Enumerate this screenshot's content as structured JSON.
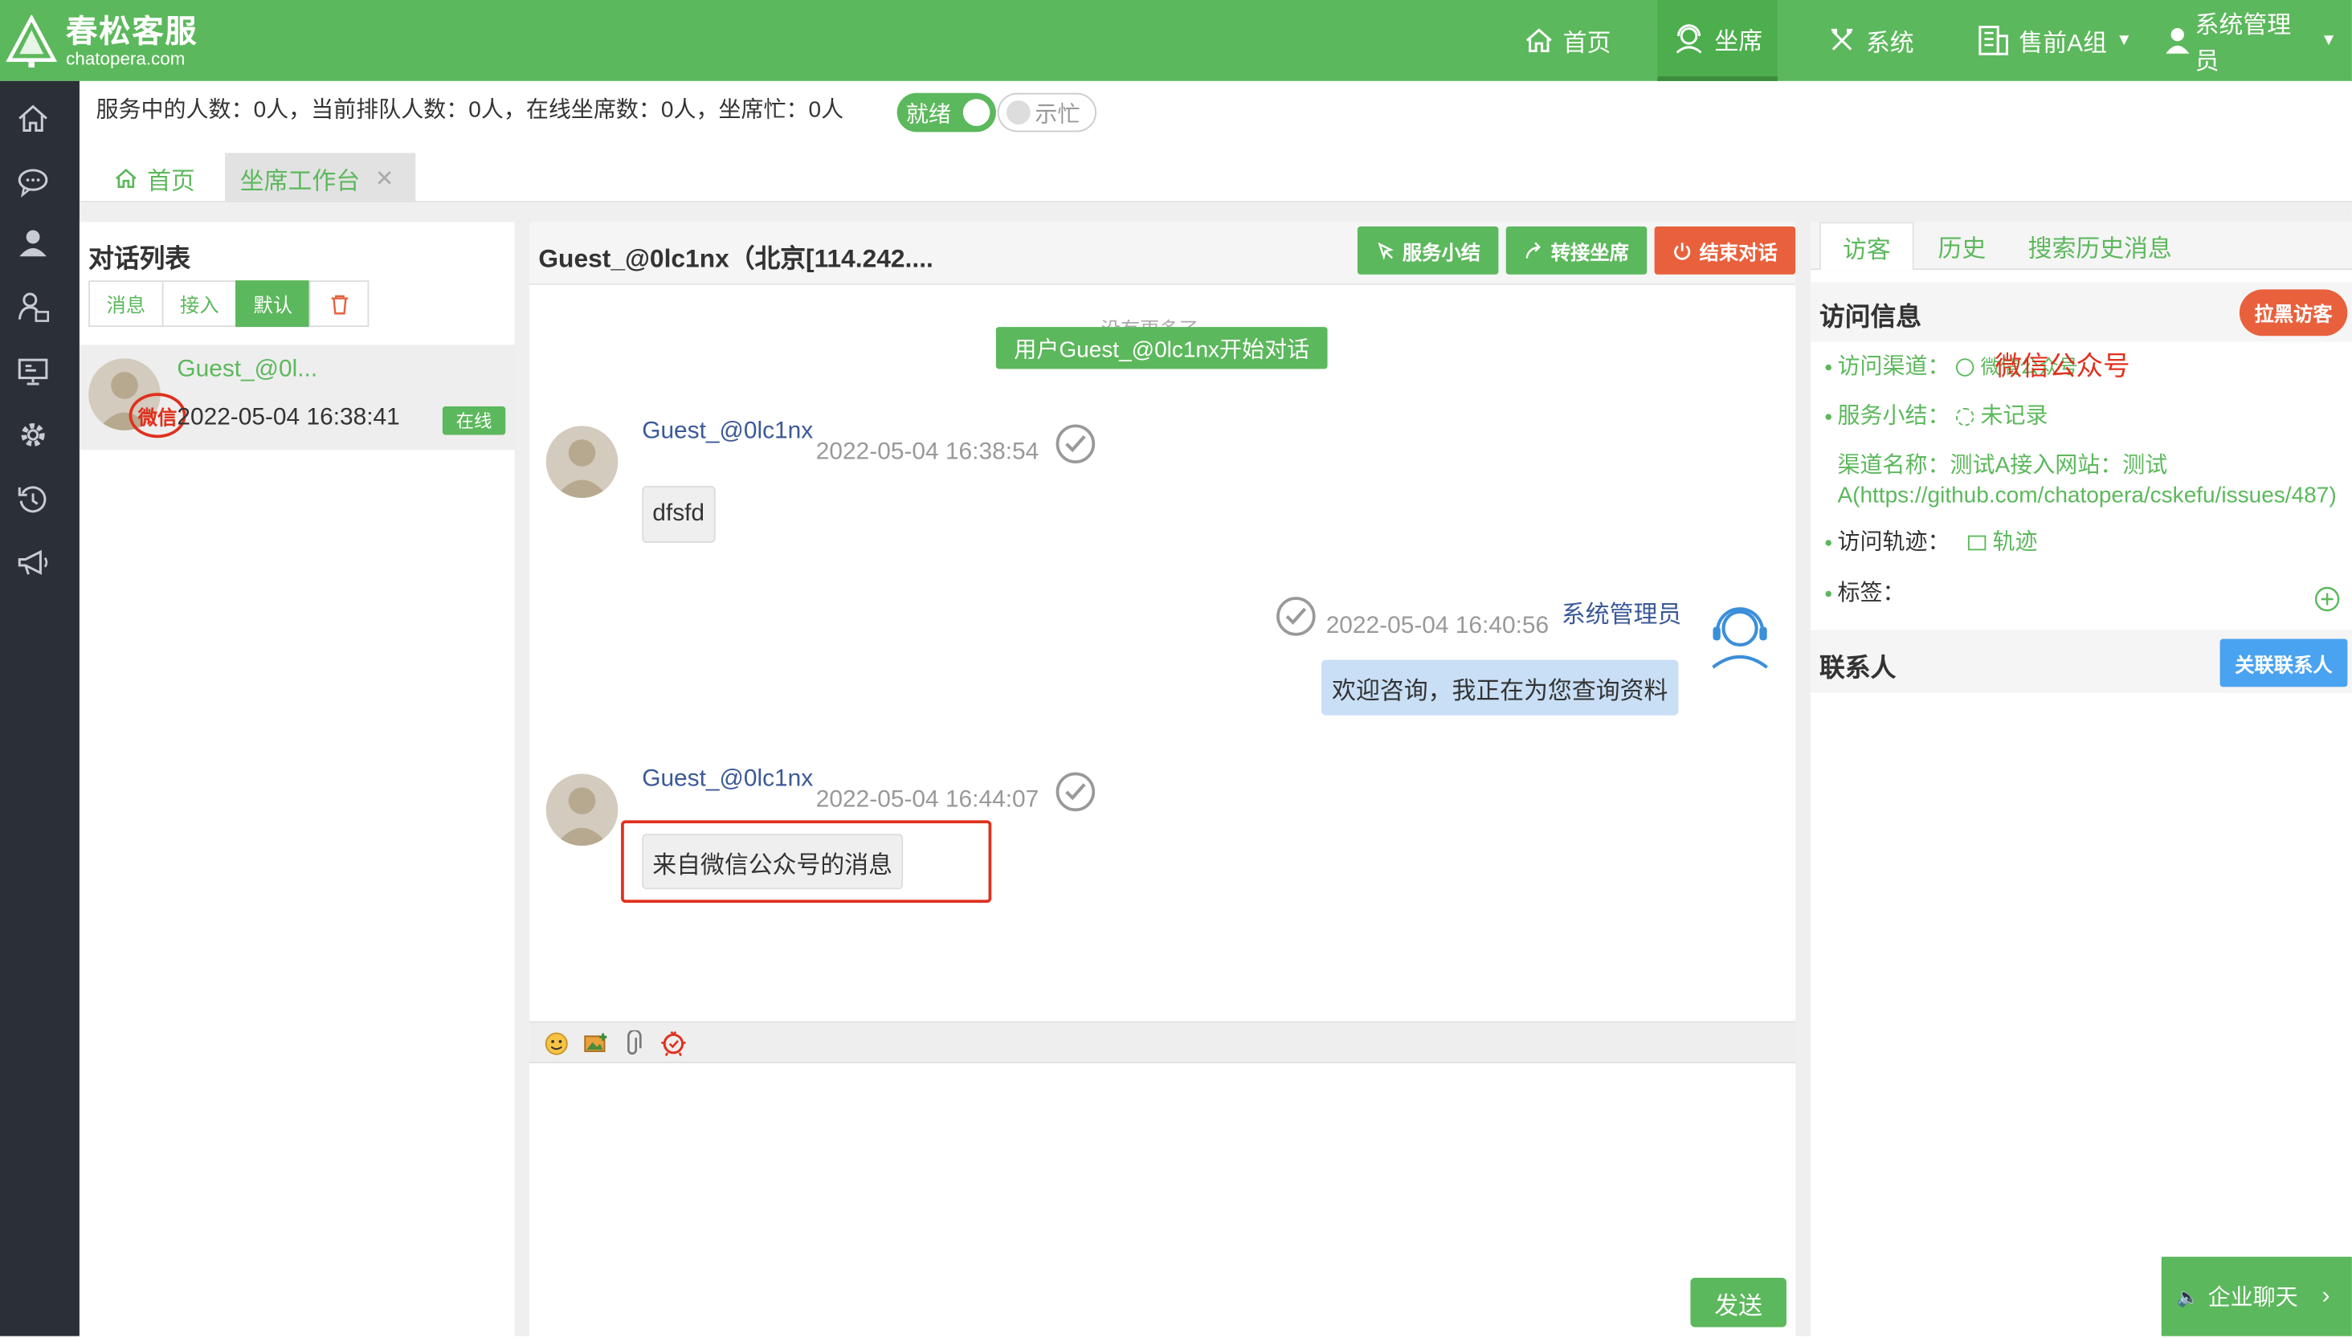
{
  "header": {
    "brand_name": "春松客服",
    "brand_url": "chatopera.com",
    "nav": [
      {
        "label": "首页",
        "icon": "home-icon"
      },
      {
        "label": "坐席",
        "icon": "agent-icon",
        "active": true
      },
      {
        "label": "系统",
        "icon": "tools-icon"
      },
      {
        "label": "售前A组",
        "icon": "building-icon"
      },
      {
        "label": "系统管理员",
        "icon": "user-icon"
      }
    ]
  },
  "sidebar": {
    "icons": [
      "home-icon",
      "chat-icon",
      "user-icon",
      "contact-icon",
      "monitor-icon",
      "gear-icon",
      "history-icon",
      "megaphone-icon"
    ]
  },
  "stats": {
    "text": "服务中的人数：0人，当前排队人数：0人，在线坐席数：0人，坐席忙：0人",
    "ready_label": "就绪",
    "busy_label": "示忙"
  },
  "tabs": [
    {
      "label": "首页"
    },
    {
      "label": "坐席工作台"
    }
  ],
  "conversation_list": {
    "title": "对话列表",
    "filters": [
      "消息",
      "接入",
      "默认"
    ],
    "items": [
      {
        "name": "Guest_@0l...",
        "time": "2022-05-04 16:38:41",
        "status": "在线",
        "channel_badge": "微信"
      }
    ]
  },
  "chat": {
    "title": "Guest_@0lc1nx（北京[114.242....",
    "actions": {
      "summary": "服务小结",
      "transfer": "转接坐席",
      "end": "结束对话"
    },
    "no_more": "没有更多了",
    "system_notice": "用户Guest_@0lc1nx开始对话",
    "messages": [
      {
        "sender": "Guest_@0lc1nx",
        "time": "2022-05-04 16:38:54",
        "text": "dfsfd"
      },
      {
        "sender": "系统管理员",
        "time": "2022-05-04 16:40:56",
        "text": "欢迎咨询，我正在为您查询资料"
      },
      {
        "sender": "Guest_@0lc1nx",
        "time": "2022-05-04 16:44:07",
        "text": "来自微信公众号的消息"
      }
    ],
    "send_label": "发送"
  },
  "visitor": {
    "tabs": [
      "访客",
      "历史",
      "搜索历史消息"
    ],
    "info_title": "访问信息",
    "blacklist_label": "拉黑访客",
    "annotation": "微信公众号",
    "info": {
      "channel_label": "访问渠道：",
      "channel_value": "微信公众号",
      "summary_label": "服务小结：",
      "summary_value": "未记录",
      "channel_name_label": "渠道名称：",
      "channel_name_value": "测试A接入网站：测试",
      "channel_name_link": "A(https://github.com/chatopera/cskefu/issues/487)",
      "trace_label": "访问轨迹：",
      "trace_value": "轨迹",
      "tag_label": "标签："
    },
    "contacts_title": "联系人",
    "link_contact_label": "关联联系人"
  },
  "enterprise_chat": {
    "label": "企业聊天"
  },
  "colors": {
    "primary": "#5cb85c",
    "danger": "#e8613c",
    "link": "#3b5998",
    "sidebar": "#2b2f36"
  }
}
